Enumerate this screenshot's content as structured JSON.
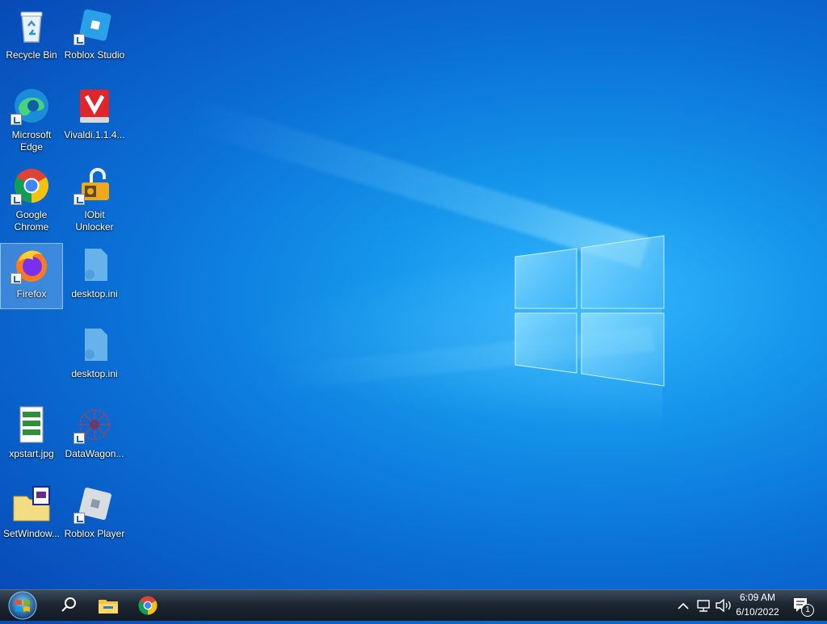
{
  "desktop": {
    "icons": [
      {
        "id": "recycle-bin",
        "label": "Recycle Bin"
      },
      {
        "id": "roblox-studio",
        "label": "Roblox Studio"
      },
      {
        "id": "microsoft-edge",
        "label": "Microsoft Edge"
      },
      {
        "id": "vivaldi",
        "label": "Vivaldi.1.1.4..."
      },
      {
        "id": "google-chrome",
        "label": "Google Chrome"
      },
      {
        "id": "iobit-unlocker",
        "label": "IObit Unlocker"
      },
      {
        "id": "firefox",
        "label": "Firefox"
      },
      {
        "id": "desktop-ini-1",
        "label": "desktop.ini"
      },
      {
        "id": "desktop-ini-2",
        "label": "desktop.ini"
      },
      {
        "id": "xpstart",
        "label": "xpstart.jpg"
      },
      {
        "id": "datawagon",
        "label": "DataWagon..."
      },
      {
        "id": "setwindow",
        "label": "SetWindow..."
      },
      {
        "id": "roblox-player",
        "label": "Roblox Player"
      }
    ]
  },
  "taskbar": {
    "pinned": [
      "search-icon",
      "file-explorer-icon",
      "chrome-icon"
    ],
    "clock": {
      "time": "6:09 AM",
      "date": "6/10/2022"
    },
    "notifications_count": "1"
  },
  "colors": {
    "accent": "#0a6fd6",
    "taskbar": "#1d2732"
  }
}
